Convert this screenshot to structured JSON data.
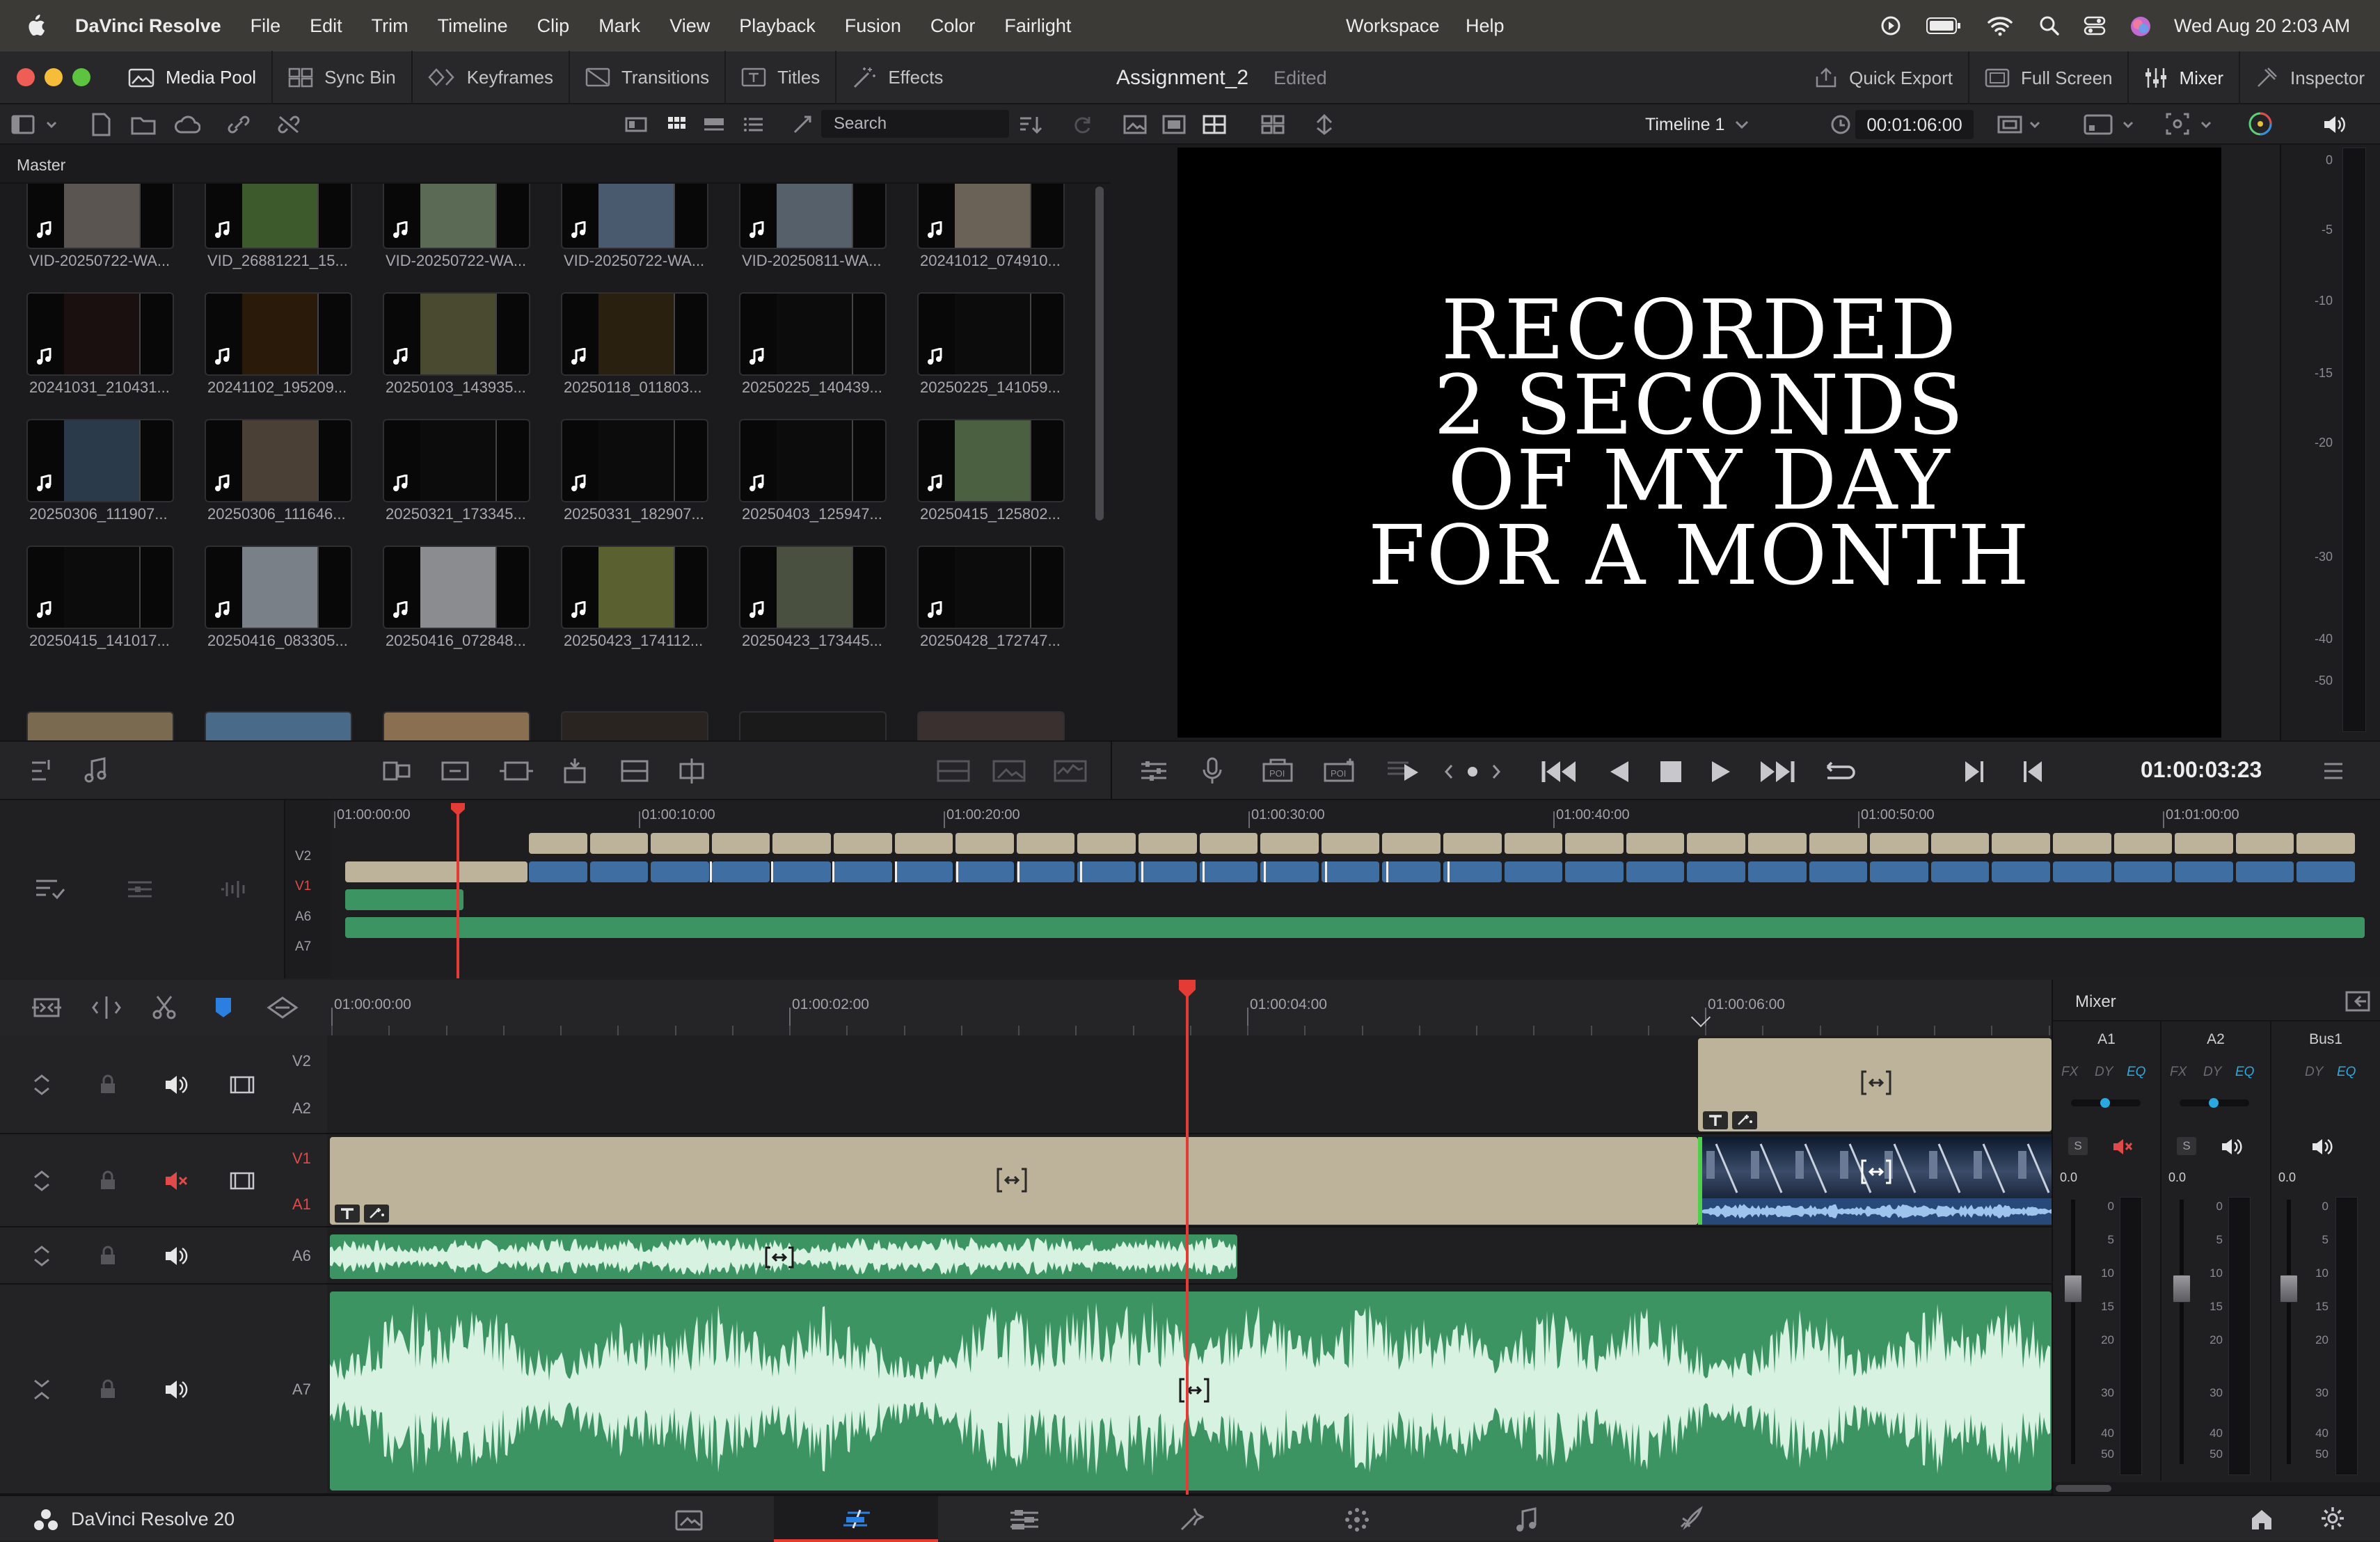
{
  "menubar": {
    "app_name": "DaVinci Resolve",
    "items": [
      "File",
      "Edit",
      "Trim",
      "Timeline",
      "Clip",
      "Mark",
      "View",
      "Playback",
      "Fusion",
      "Color",
      "Fairlight"
    ],
    "center_items": [
      "Workspace",
      "Help"
    ],
    "datetime": "Wed Aug 20  2:03 AM"
  },
  "toolbar": {
    "media_pool": "Media Pool",
    "sync_bin": "Sync Bin",
    "keyframes": "Keyframes",
    "transitions": "Transitions",
    "titles": "Titles",
    "effects": "Effects",
    "project_name": "Assignment_2",
    "project_status": "Edited",
    "quick_export": "Quick Export",
    "full_screen": "Full Screen",
    "mixer": "Mixer",
    "inspector": "Inspector"
  },
  "pool": {
    "search_placeholder": "Search",
    "bin": "Master",
    "clips": [
      {
        "name": "VID-20250722-WA...",
        "tone": "#5a5550"
      },
      {
        "name": "VID_26881221_15...",
        "tone": "#3c5a2c"
      },
      {
        "name": "VID-20250722-WA...",
        "tone": "#5b6a55"
      },
      {
        "name": "VID-20250722-WA...",
        "tone": "#4a5a6e"
      },
      {
        "name": "VID-20250811-WA...",
        "tone": "#56606a"
      },
      {
        "name": "20241012_074910...",
        "tone": "#6a6256"
      },
      {
        "name": "20241031_210431...",
        "tone": "#1a1010"
      },
      {
        "name": "20241102_195209...",
        "tone": "#2a1a0a"
      },
      {
        "name": "20250103_143935...",
        "tone": "#4a4a30"
      },
      {
        "name": "20250118_011803...",
        "tone": "#2a2010"
      },
      {
        "name": "20250225_140439...",
        "tone": "#0c0c0c"
      },
      {
        "name": "20250225_141059...",
        "tone": "#0c0c0c"
      },
      {
        "name": "20250306_111907...",
        "tone": "#2a3a4a"
      },
      {
        "name": "20250306_111646...",
        "tone": "#4a4036"
      },
      {
        "name": "20250321_173345...",
        "tone": "#0c0c0c"
      },
      {
        "name": "20250331_182907...",
        "tone": "#0c0c0c"
      },
      {
        "name": "20250403_125947...",
        "tone": "#0c0c0c"
      },
      {
        "name": "20250415_125802...",
        "tone": "#4a6040"
      },
      {
        "name": "20250415_141017...",
        "tone": "#0c0c0c"
      },
      {
        "name": "20250416_083305...",
        "tone": "#7a8088"
      },
      {
        "name": "20250416_072848...",
        "tone": "#8a8c90"
      },
      {
        "name": "20250423_174112...",
        "tone": "#5a6030"
      },
      {
        "name": "20250423_173445...",
        "tone": "#4a5040"
      },
      {
        "name": "20250428_172747...",
        "tone": "#0c0c0c"
      }
    ]
  },
  "viewer": {
    "timeline_name": "Timeline 1",
    "duration": "00:01:06:00",
    "title_lines": [
      "RECORDED",
      "2 SECONDS",
      "OF MY DAY",
      "FOR A MONTH"
    ],
    "timecode": "01:00:03:23",
    "meter_scale": [
      "0",
      "-5",
      "-10",
      "-15",
      "-20",
      "-30",
      "-40",
      "-50"
    ]
  },
  "mini_timeline": {
    "ruler": [
      "01:00:00:00",
      "01:00:10:00",
      "01:00:20:00",
      "01:00:30:00",
      "01:00:40:00",
      "01:00:50:00",
      "01:01:00:00"
    ],
    "tracks": [
      "V2",
      "V1",
      "A6",
      "A7"
    ]
  },
  "timeline": {
    "ruler": [
      "01:00:00:00",
      "01:00:02:00",
      "01:00:04:00",
      "01:00:06:00"
    ],
    "tracks": {
      "v2": "V2",
      "a2": "A2",
      "v1": "V1",
      "a1": "A1",
      "a6": "A6",
      "a7": "A7"
    }
  },
  "mixer": {
    "title": "Mixer",
    "channels": [
      {
        "name": "A1",
        "level": "0.0",
        "buttons": [
          "FX",
          "DY",
          "EQ"
        ]
      },
      {
        "name": "A2",
        "level": "0.0",
        "buttons": [
          "FX",
          "DY",
          "EQ"
        ]
      },
      {
        "name": "Bus1",
        "level": "0.0",
        "buttons": [
          "DY",
          "EQ"
        ]
      }
    ],
    "fader_scale": [
      "0",
      "5",
      "10",
      "15",
      "20",
      "30",
      "40",
      "50"
    ],
    "solo": "S"
  },
  "bottombar": {
    "app_label": "DaVinci Resolve 20"
  },
  "colors": {
    "title_clip": "#bdb39a",
    "video_clip": "#3f6ea3",
    "audio_clip": "#3c9463",
    "waveform": "#d8f2e2",
    "playhead": "#e43b36",
    "accent": "#2aa9e0"
  }
}
